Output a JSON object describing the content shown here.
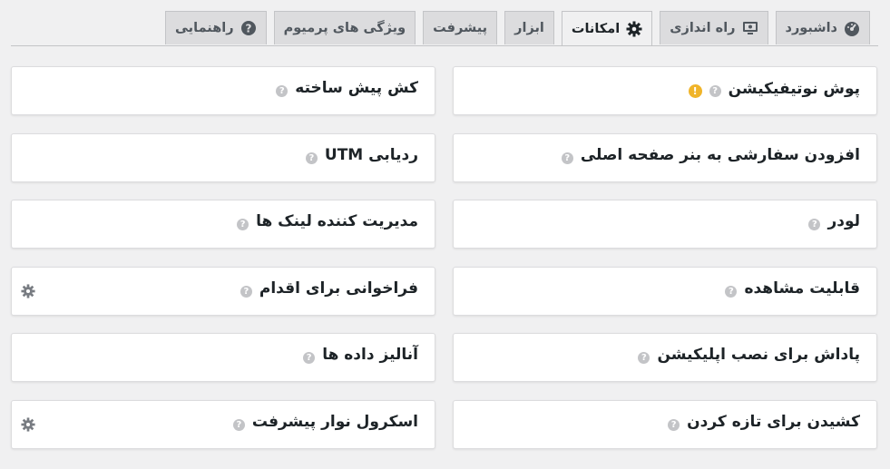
{
  "tabs": [
    {
      "label": "داشبورد",
      "icon": "dashboard-icon"
    },
    {
      "label": "راه اندازی",
      "icon": "setup-icon"
    },
    {
      "label": "امکانات",
      "icon": "gear-icon"
    },
    {
      "label": "ابزار"
    },
    {
      "label": "پیشرفت"
    },
    {
      "label": "ویژگی های پرمیوم"
    },
    {
      "label": "راهنمایی",
      "icon": "question-circle-icon"
    }
  ],
  "active_tab": "امکانات",
  "help_glyph": "?",
  "warn_glyph": "!",
  "colors": {
    "accent_warning": "#f0b429",
    "background": "#f0f0f1"
  },
  "features": {
    "right": [
      {
        "title": "پوش نوتیفیکیشن"
      },
      {
        "title": "افزودن سفارشی به بنر صفحه اصلی"
      },
      {
        "title": "لودر"
      },
      {
        "title": "قابلیت مشاهده"
      },
      {
        "title": "پاداش برای نصب اپلیکیشن"
      },
      {
        "title": "کشیدن برای تازه کردن"
      }
    ],
    "left": [
      {
        "title": "کش پیش ساخته"
      },
      {
        "title": "ردیابی UTM"
      },
      {
        "title": "مدیریت کننده لینک ها"
      },
      {
        "title": "فراخوانی برای اقدام"
      },
      {
        "title": "آنالیز داده ها"
      },
      {
        "title": "اسکرول نوار پیشرفت"
      }
    ]
  }
}
